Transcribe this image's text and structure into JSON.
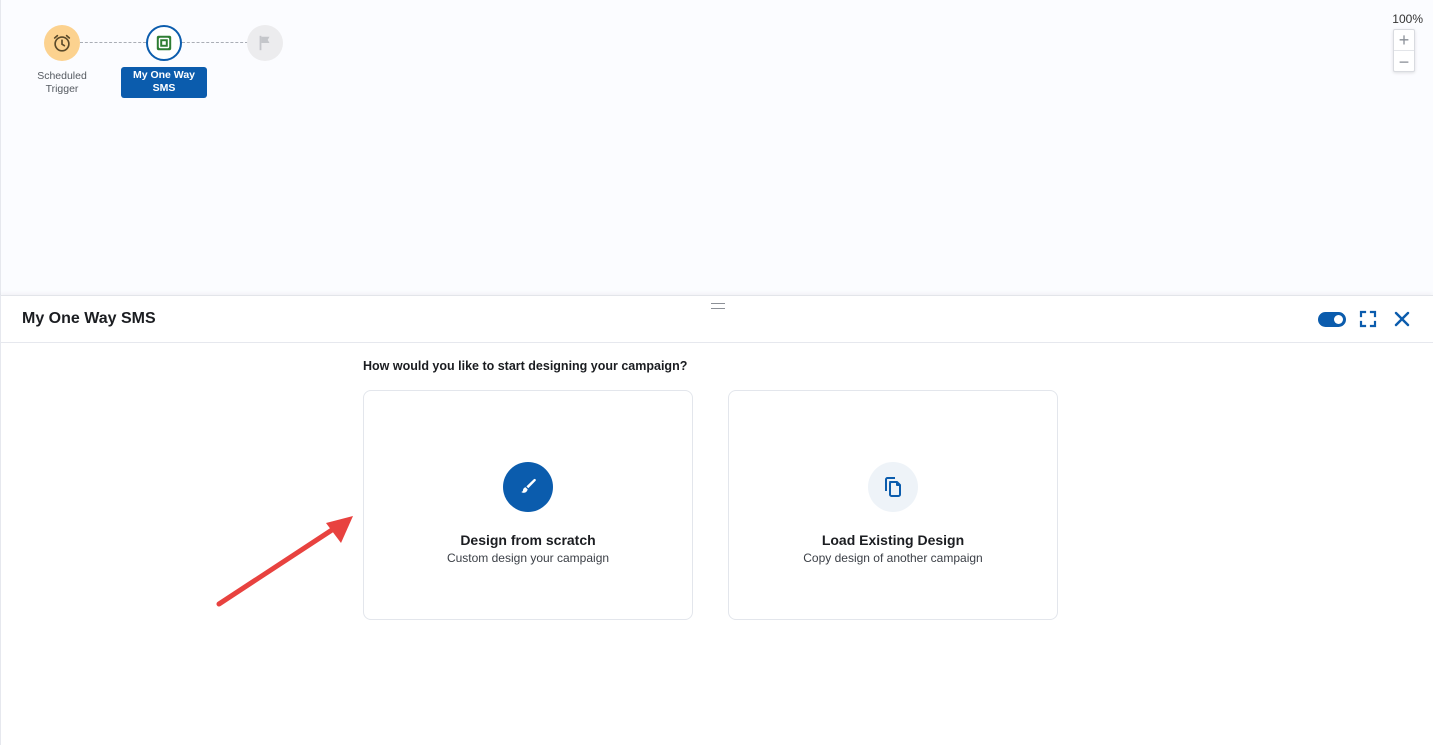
{
  "canvas": {
    "nodes": [
      {
        "label": "Scheduled\nTrigger",
        "icon": "alarm-clock-icon"
      },
      {
        "label": "My One Way SMS",
        "icon": "sms-message-icon"
      },
      {
        "label": "",
        "icon": "flag-icon"
      }
    ],
    "node_labels": {
      "trigger_line1": "Scheduled",
      "trigger_line2": "Trigger",
      "sms_line1": "My One Way",
      "sms_line2": "SMS"
    },
    "zoom": {
      "level": "100%",
      "zoom_in_label": "+",
      "zoom_out_label": "−"
    }
  },
  "panel": {
    "title": "My One Way SMS",
    "toggle_on": true,
    "question": "How would you like to start designing your campaign?",
    "options": [
      {
        "title": "Design from scratch",
        "subtitle": "Custom design your campaign",
        "icon": "paintbrush-icon"
      },
      {
        "title": "Load Existing Design",
        "subtitle": "Copy design of another campaign",
        "icon": "copy-document-icon"
      }
    ]
  },
  "colors": {
    "primary": "#0b5cad",
    "trigger_node": "#fcd28f",
    "annotation_arrow": "#e8423f"
  }
}
